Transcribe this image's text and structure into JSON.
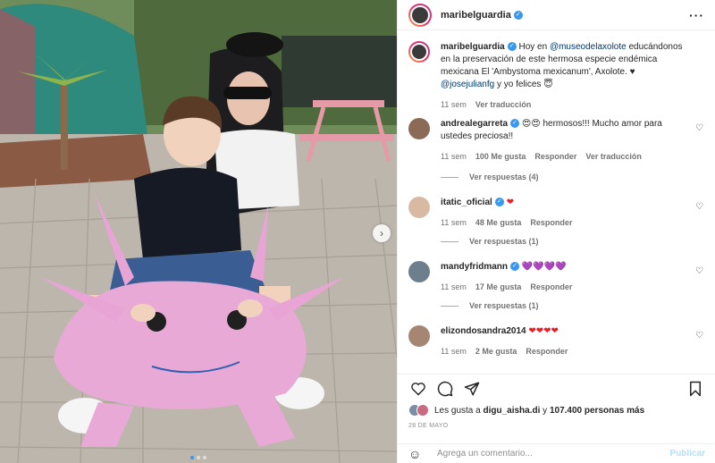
{
  "post": {
    "username": "maribelguardia",
    "verified": true
  },
  "caption": {
    "username": "maribelguardia",
    "text_1": "Hoy en ",
    "mention_1": "@museodelaxolote",
    "text_2": " educándonos en la preservación de este hermosa especie endémica mexicana El 'Ambystoma mexicanum', Axolote. ♥ ",
    "mention_2": "@josejulianfg",
    "text_3": " y yo felices 😇",
    "time": "11 sem",
    "see_translation": "Ver traducción"
  },
  "comments": [
    {
      "username": "andrealegarreta",
      "verified": true,
      "text": "😍😍 hermosos!!! Mucho amor para ustedes preciosa!!",
      "time": "11 sem",
      "likes": "100 Me gusta",
      "reply": "Responder",
      "translate": "Ver traducción",
      "replies_label": "Ver respuestas (4)"
    },
    {
      "username": "itatic_oficial",
      "verified": true,
      "text": "❤",
      "time": "11 sem",
      "likes": "48 Me gusta",
      "reply": "Responder",
      "replies_label": "Ver respuestas (1)"
    },
    {
      "username": "mandyfridmann",
      "verified": true,
      "text": "💜💜💜💜",
      "time": "11 sem",
      "likes": "17 Me gusta",
      "reply": "Responder",
      "replies_label": "Ver respuestas (1)"
    },
    {
      "username": "elizondosandra2014",
      "verified": false,
      "text": "❤❤❤❤",
      "time": "11 sem",
      "likes": "2 Me gusta",
      "reply": "Responder"
    }
  ],
  "likes": {
    "prefix": "Les gusta a ",
    "user": "digu_aisha.di",
    "middle": " y ",
    "count": "107.400 personas más"
  },
  "date": "28 DE MAYO",
  "composer": {
    "placeholder": "Agrega un comentario...",
    "publish": "Publicar"
  },
  "icons": {
    "options": "more-options-icon",
    "like": "heart-icon",
    "comment": "comment-icon",
    "share": "share-icon",
    "save": "bookmark-icon",
    "emoji": "emoji-icon",
    "next": "chevron-right-icon"
  },
  "carousel": {
    "slides": 3,
    "active_slide": 1
  },
  "colors": {
    "link": "#00376b",
    "verified": "#3897f0",
    "muted": "#737373",
    "publish_disabled": "#b2dffc"
  }
}
